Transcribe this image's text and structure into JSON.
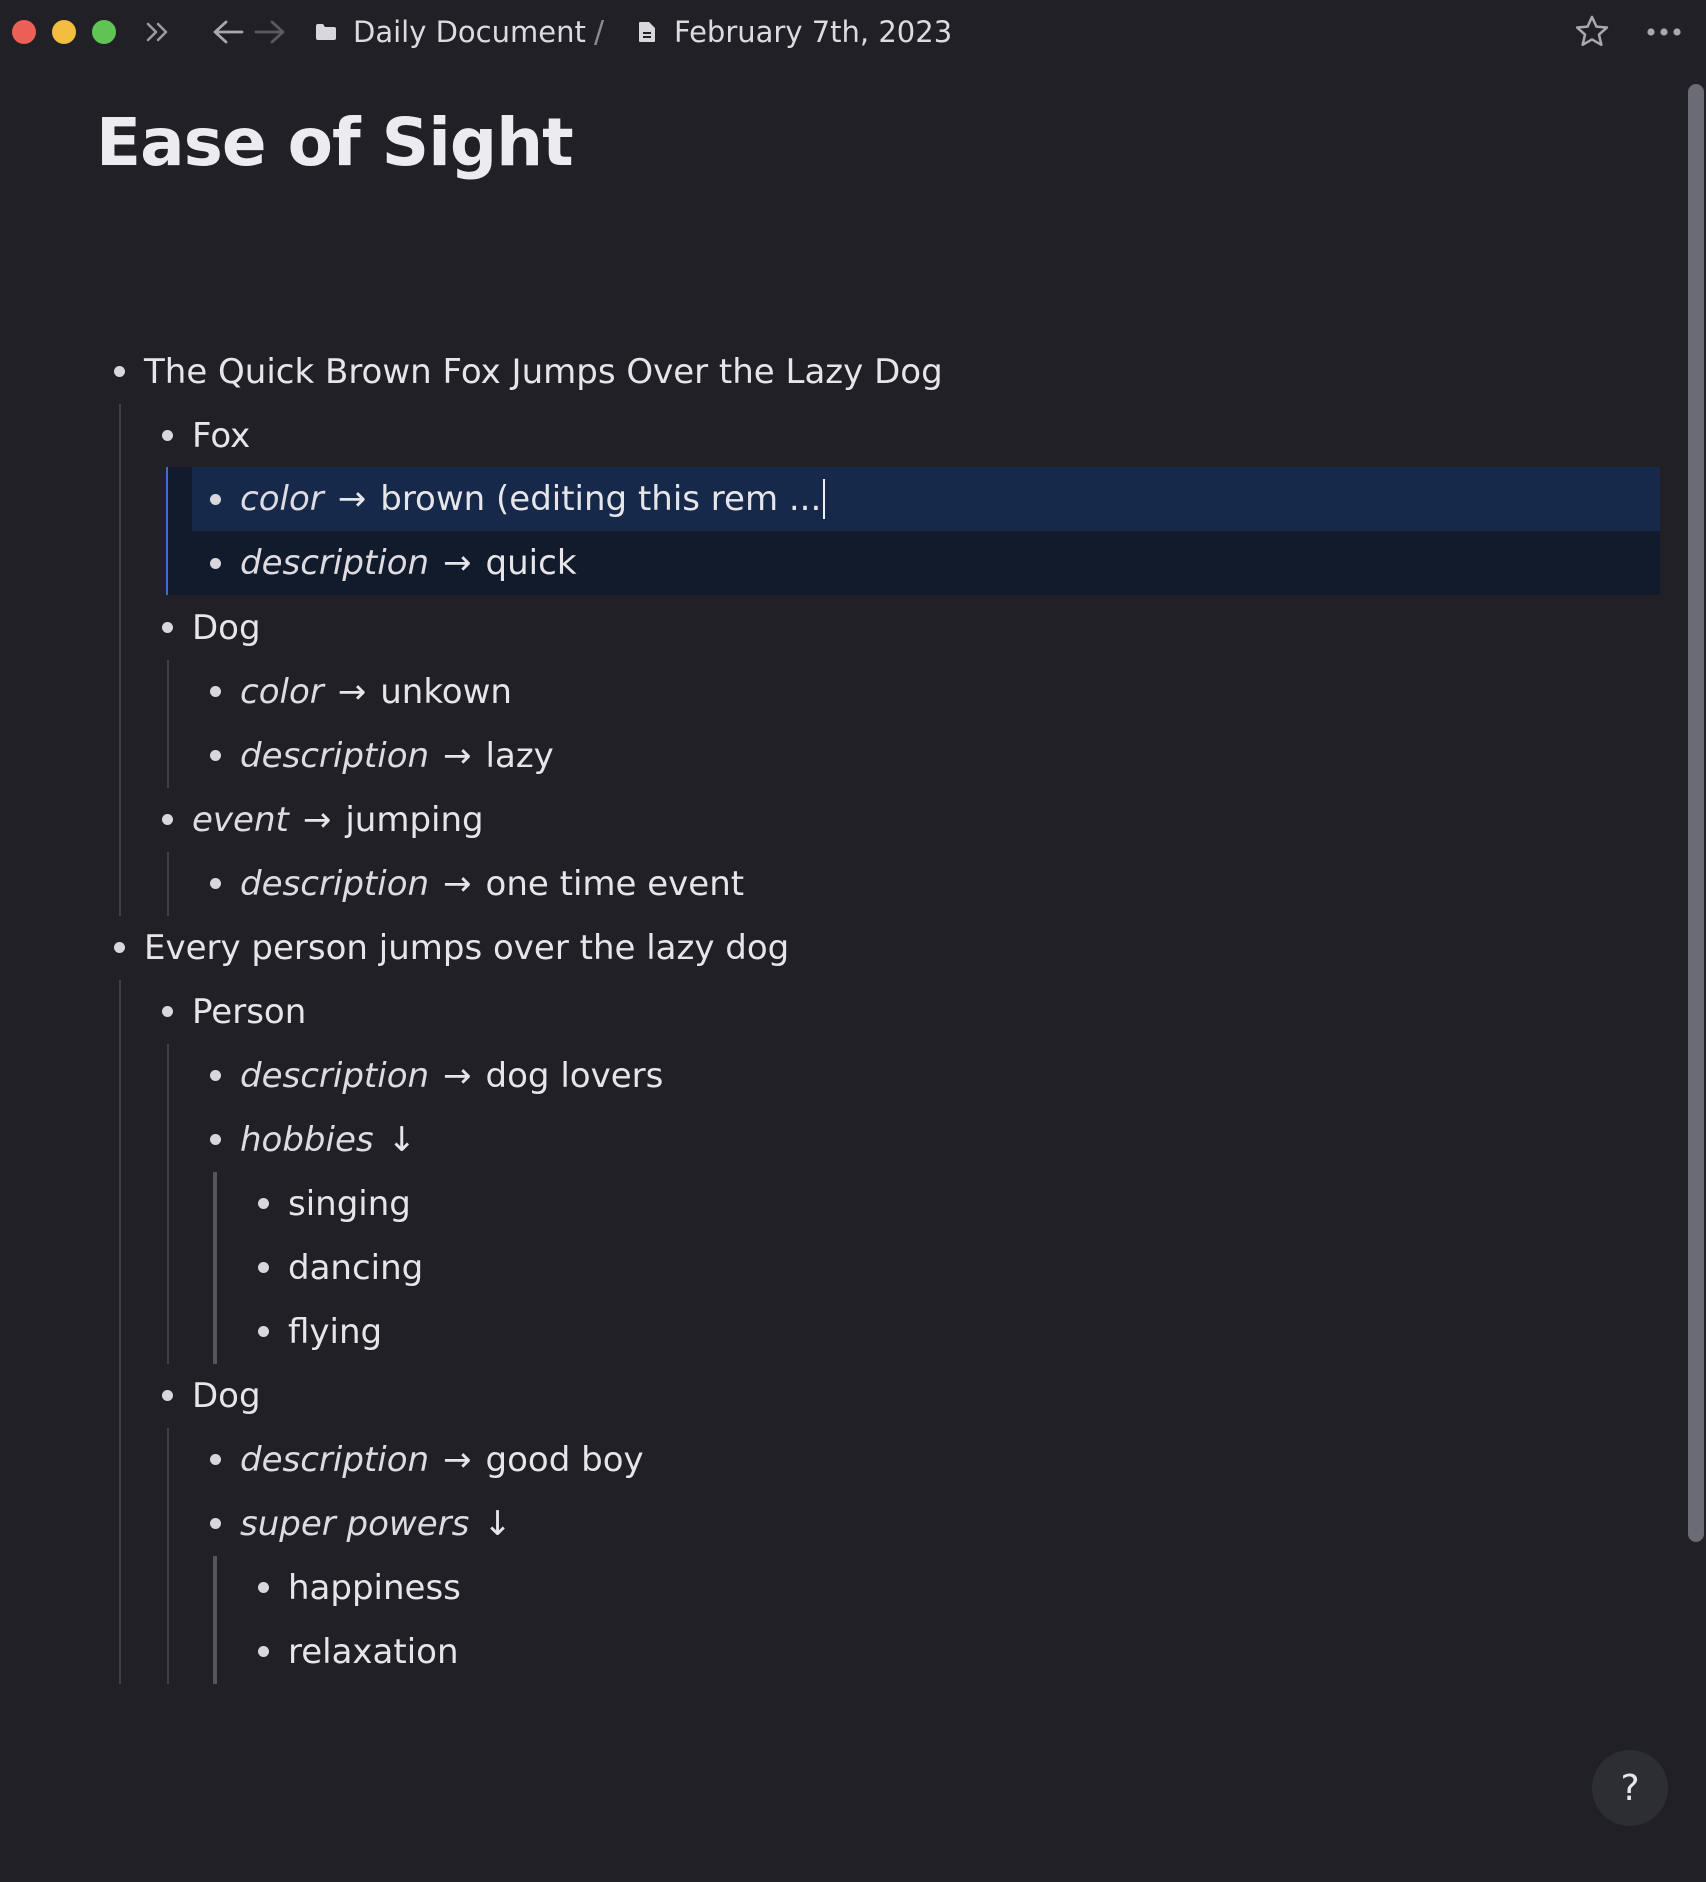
{
  "toolbar": {
    "breadcrumb_folder": "Daily Document",
    "breadcrumb_separator": "/",
    "breadcrumb_doc": "February 7th, 2023",
    "icons": [
      "sidebar-toggle-icon",
      "back-arrow-icon",
      "forward-arrow-icon",
      "folder-icon",
      "document-icon",
      "star-icon",
      "more-icon"
    ]
  },
  "document": {
    "title": "Ease of Sight",
    "arrow": "→",
    "down_arrow": "↓",
    "rows": {
      "r1": "The Quick Brown Fox Jumps Over the Lazy Dog",
      "r2": "Fox",
      "r3_key": "color",
      "r3_val": "brown (editing this rem ...",
      "r4_key": "description",
      "r4_val": "quick",
      "r5": "Dog",
      "r6_key": "color",
      "r6_val": "unkown",
      "r7_key": "description",
      "r7_val": "lazy",
      "r8_key": "event",
      "r8_val": "jumping",
      "r9_key": "description",
      "r9_val": "one time event",
      "r10": "Every person jumps over the lazy dog",
      "r11": "Person",
      "r12_key": "description",
      "r12_val": "dog lovers",
      "r13_key": "hobbies",
      "r14": "singing",
      "r15": "dancing",
      "r16": "flying",
      "r17": "Dog",
      "r18_key": "description",
      "r18_val": "good boy",
      "r19_key": "super powers",
      "r20": "happiness",
      "r21": "relaxation"
    }
  },
  "help": {
    "label": "?"
  },
  "colors": {
    "background": "#202026",
    "selection": "#121b2b",
    "focus_row": "#17294a",
    "selection_bar": "#3a6fd1"
  }
}
